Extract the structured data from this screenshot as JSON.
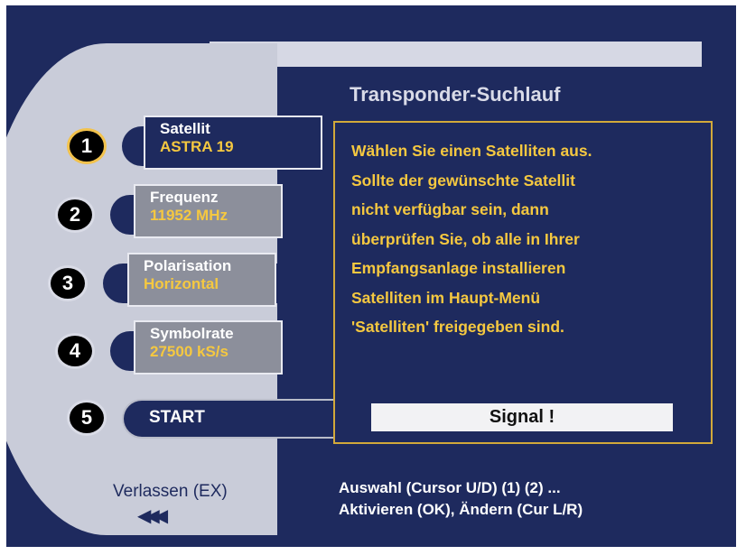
{
  "title": "Transponder-Suchlauf",
  "rows": [
    {
      "num": "1",
      "label": "Satellit",
      "value": "ASTRA 19"
    },
    {
      "num": "2",
      "label": "Frequenz",
      "value": "11952 MHz"
    },
    {
      "num": "3",
      "label": "Polarisation",
      "value": "Horizontal"
    },
    {
      "num": "4",
      "label": "Symbolrate",
      "value": "27500 kS/s"
    }
  ],
  "start": {
    "num": "5",
    "label": "START"
  },
  "info_lines": [
    "Wählen Sie einen Satelliten aus.",
    "Sollte der gewünschte Satellit",
    "nicht verfügbar sein, dann",
    "überprüfen Sie, ob alle in Ihrer",
    "Empfangsanlage installieren",
    "Satelliten im Haupt-Menü",
    "'Satelliten' freigegeben sind."
  ],
  "signal_label": "Signal !",
  "exit_label": "Verlassen (EX)",
  "exit_arrows": "◀◀◀",
  "help": {
    "line1": "Auswahl (Cursor U/D) (1) (2) ...",
    "line2": "Aktivieren (OK), Ändern (Cur L/R)"
  },
  "colors": {
    "background": "#1e2a5e",
    "panel": "#c9ccd9",
    "highlight_text": "#f5c840",
    "frame": "#d2a93a"
  }
}
